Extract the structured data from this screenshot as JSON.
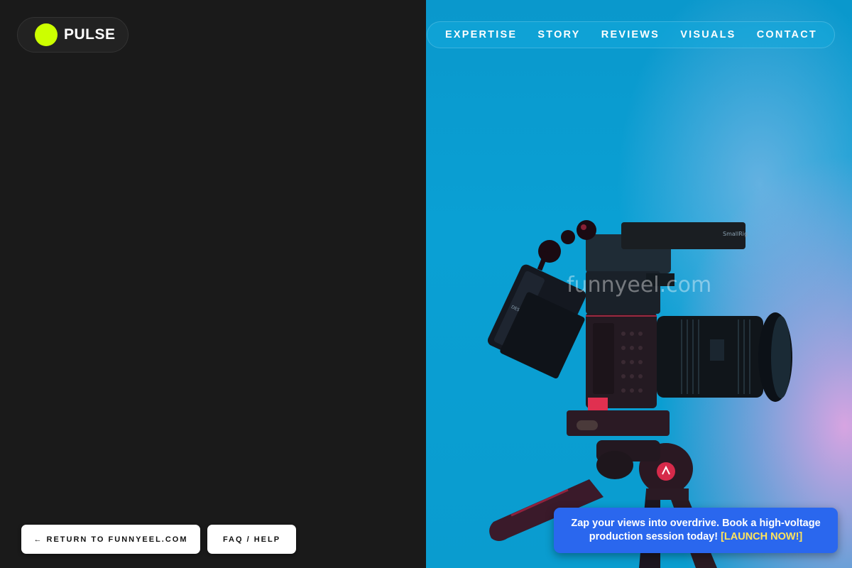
{
  "brand": {
    "name": "PULSE",
    "dot_color": "#ccff00"
  },
  "nav": {
    "items": [
      {
        "label": "EXPERTISE"
      },
      {
        "label": "STORY"
      },
      {
        "label": "REVIEWS"
      },
      {
        "label": "VISUALS"
      },
      {
        "label": "CONTACT"
      }
    ]
  },
  "hero": {
    "watermark": "funnyeel.com",
    "mic_brand": "SmallRig",
    "monitor_label": "DESVIEW"
  },
  "footer": {
    "return_label": "← RETURN TO FUNNYEEL.COM",
    "faq_label": "FAQ / HELP"
  },
  "promo": {
    "text": "Zap your views into overdrive. Book a high-voltage production session today! ",
    "cta": "[LAUNCH NOW!]"
  },
  "colors": {
    "left_bg": "#1a1a1a",
    "sky_blue": "#0a9ccf",
    "accent_pink": "#e2a4e2",
    "promo_bg": "#2a67ee",
    "cta_yellow": "#ffe45c"
  }
}
